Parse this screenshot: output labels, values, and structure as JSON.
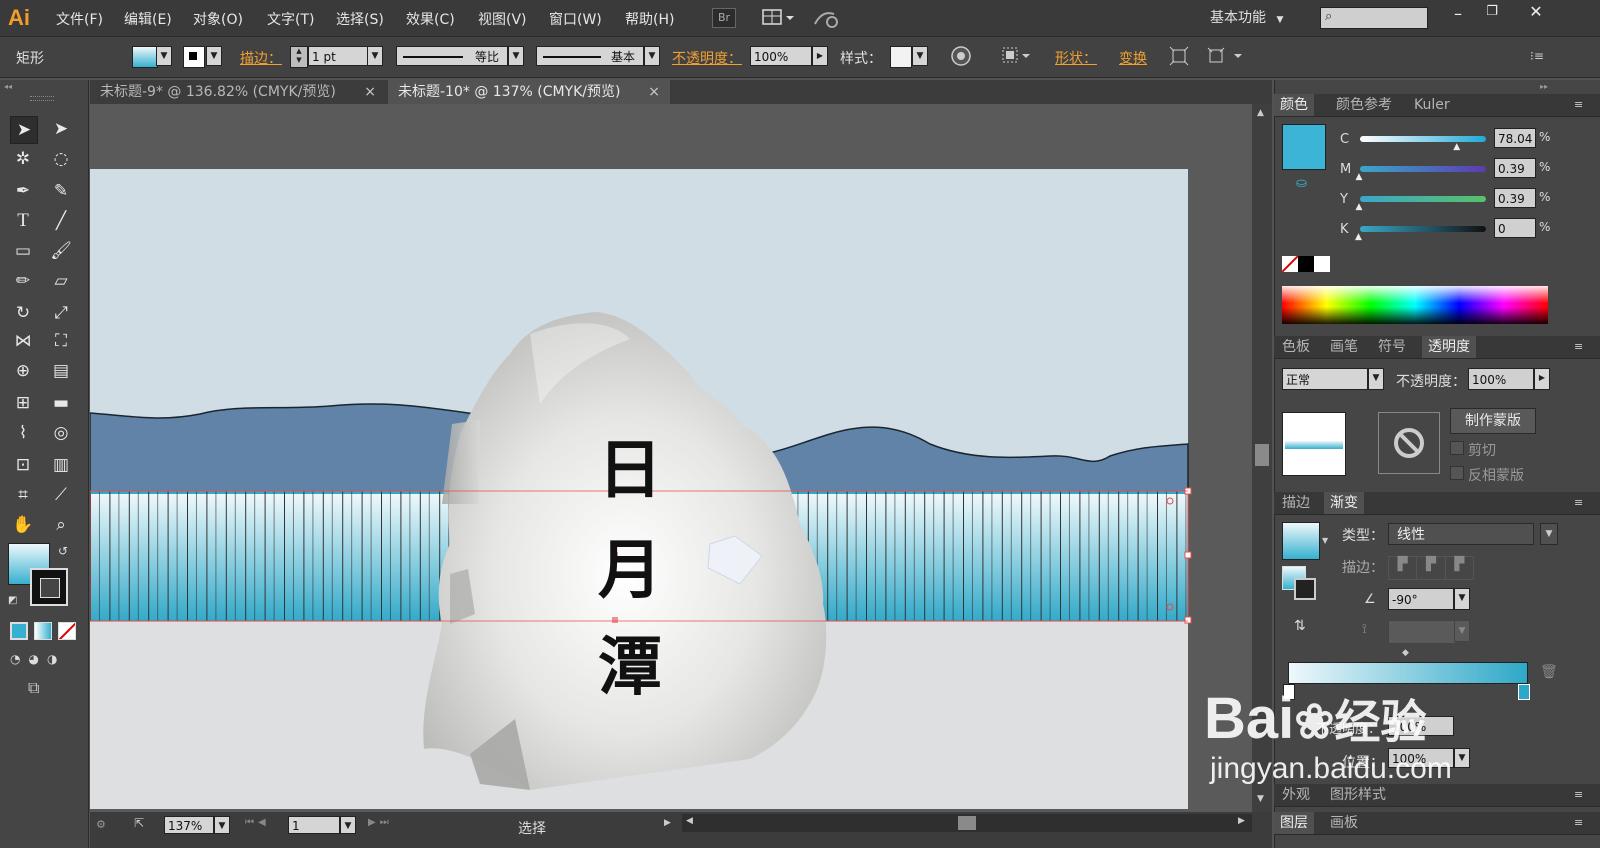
{
  "app": {
    "logo": "Ai"
  },
  "menubar": {
    "items": [
      "文件(F)",
      "编辑(E)",
      "对象(O)",
      "文字(T)",
      "选择(S)",
      "效果(C)",
      "视图(V)",
      "窗口(W)",
      "帮助(H)"
    ],
    "bridge_label": "Br",
    "workspace_label": "基本功能",
    "search_placeholder": ""
  },
  "controlbar": {
    "object_type": "矩形",
    "stroke_label": "描边：",
    "stroke_weight": "1 pt",
    "profile_label": "等比",
    "brush_label": "基本",
    "opacity_label": "不透明度：",
    "opacity_value": "100%",
    "style_label": "样式：",
    "shape_label": "形状：",
    "transform_label": "变换"
  },
  "tabs": [
    {
      "label": "未标题-9* @ 136.82% (CMYK/预览)",
      "close": "×"
    },
    {
      "label": "未标题-10* @ 137% (CMYK/预览)",
      "close": "×"
    }
  ],
  "artwork": {
    "characters": [
      "日",
      "月",
      "潭"
    ],
    "sky_color": "#d0dde4",
    "mountain_color": "#6283a8",
    "ground_color": "#dddfe1",
    "fence_top_color": "#eef8fb",
    "fence_bottom_color": "#2ea8c8"
  },
  "statusbar": {
    "zoom": "137%",
    "artboard": "1",
    "mode": "选择"
  },
  "color_panel": {
    "tabs": [
      "颜色",
      "颜色参考",
      "Kuler"
    ],
    "swatch_color": "#3bb4d8",
    "channels": [
      {
        "label": "C",
        "value": "78.04",
        "pct": "%",
        "level": 0.78,
        "track": "linear-gradient(90deg,#fff,#22a9d6)"
      },
      {
        "label": "M",
        "value": "0.39",
        "pct": "%",
        "level": 0.004,
        "track": "linear-gradient(90deg,#3aa7c9,#5b3cb0)"
      },
      {
        "label": "Y",
        "value": "0.39",
        "pct": "%",
        "level": 0.004,
        "track": "linear-gradient(90deg,#3aa7c9,#59c068)"
      },
      {
        "label": "K",
        "value": "0",
        "pct": "%",
        "level": 0.0,
        "track": "linear-gradient(90deg,#3aa7c9,#101010)"
      }
    ]
  },
  "transparency_panel": {
    "tabs": [
      "色板",
      "画笔",
      "符号",
      "透明度"
    ],
    "blend_mode": "正常",
    "opacity_label": "不透明度：",
    "opacity_value": "100%",
    "make_mask_button": "制作蒙版",
    "clip_label": "剪切",
    "invert_label": "反相蒙版"
  },
  "gradient_panel": {
    "tabs": [
      "描边",
      "渐变"
    ],
    "type_label": "类型：",
    "type_value": "线性",
    "stroke_label": "描边：",
    "angle_value": "-90°",
    "opacity_label": "不透明度：",
    "opacity_value": "100%",
    "location_label": "位置：",
    "location_value": "100%"
  },
  "bottom_panels": {
    "row1": [
      "外观",
      "图形样式"
    ],
    "row2": [
      "图层",
      "画板"
    ]
  },
  "watermark": {
    "brand": "Bai",
    "brand_suffix": "经验",
    "url": "jingyan.baidu.com"
  }
}
